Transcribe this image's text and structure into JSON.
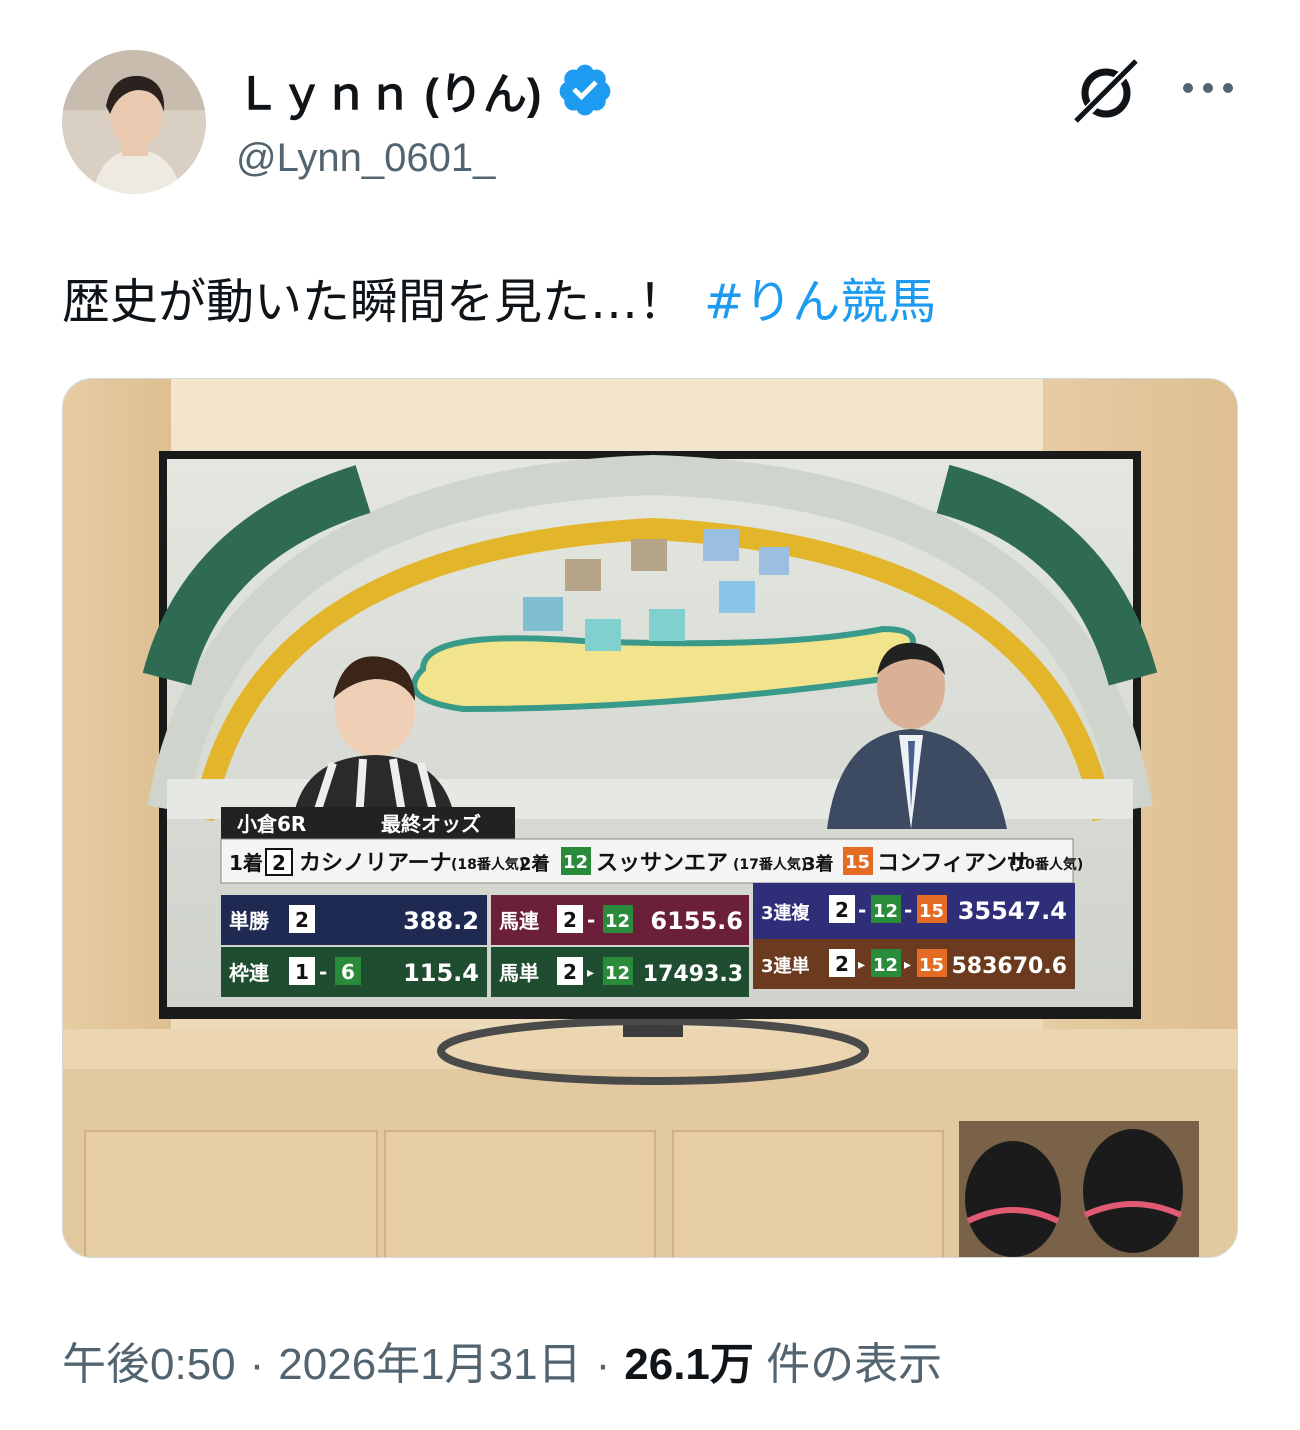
{
  "author": {
    "display_name": "Ｌｙｎｎ (りん)",
    "handle": "@Lynn_0601_",
    "verified": true,
    "avatar_icon": "profile-photo"
  },
  "header_actions": {
    "grok_icon": "grok-icon",
    "more_label": "···"
  },
  "tweet": {
    "text": "歴史が動いた瞬間を見た…！",
    "hashtag": "#りん競馬"
  },
  "media": {
    "description_icon": "photo-of-tv",
    "overlay": {
      "race": "小倉6R",
      "odds_title": "最終オッズ",
      "places": [
        {
          "place": "1着",
          "num": "2",
          "horse": "カシノリアーナ",
          "pop": "(18番人気)"
        },
        {
          "place": "2着",
          "num": "12",
          "horse": "スッサンエア",
          "pop": "(17番人気)"
        },
        {
          "place": "3着",
          "num": "15",
          "horse": "コンフィアンサ",
          "pop": "(10番人気)"
        }
      ],
      "payouts": {
        "tansho_label": "単勝",
        "tansho_nums": "2",
        "tansho_val": "388.2",
        "wakuren_label": "枠連",
        "wakuren_a": "1",
        "wakuren_b": "6",
        "wakuren_val": "115.4",
        "umaren_label": "馬連",
        "umaren_a": "2",
        "umaren_b": "12",
        "umaren_val": "6155.6",
        "umatan_label": "馬単",
        "umatan_a": "2",
        "umatan_b": "12",
        "umatan_val": "17493.3",
        "sanrenpuku_label": "3連複",
        "sanrenpuku_a": "2",
        "sanrenpuku_b": "12",
        "sanrenpuku_c": "15",
        "sanrenpuku_val": "35547.4",
        "sanrentan_label": "3連単",
        "sanrentan_a": "2",
        "sanrentan_b": "12",
        "sanrentan_c": "15",
        "sanrentan_val": "583670.6"
      }
    }
  },
  "meta": {
    "time": "午後0:50",
    "date": "2026年1月31日",
    "views": "26.1万",
    "views_suffix": "件の表示",
    "dot": "·"
  },
  "colors": {
    "hashtag": "#1d9bf0",
    "verified": "#1d9bf0",
    "muted": "#536471"
  }
}
